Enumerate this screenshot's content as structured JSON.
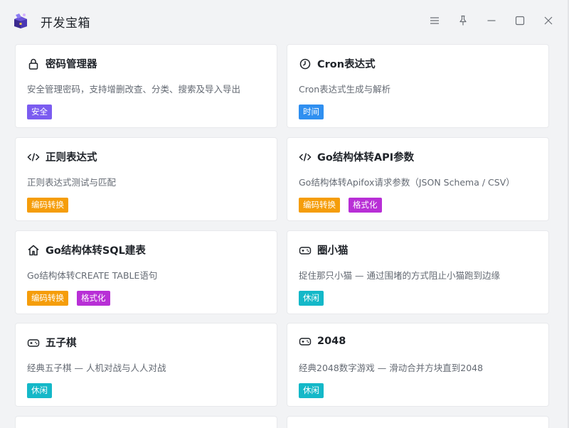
{
  "window": {
    "title": "开发宝箱",
    "controls": [
      "menu-icon",
      "pin-icon",
      "minimize-icon",
      "maximize-icon",
      "close-icon"
    ]
  },
  "colors": {
    "安全": "#7b5cf0",
    "时间": "#2f8ff0",
    "编码转换": "#f59d0a",
    "格式化": "#b82fd6",
    "休闲": "#14b8c8"
  },
  "cards": [
    {
      "title": "密码管理器",
      "icon": "lock-icon",
      "desc": "安全管理密码，支持增删改查、分类、搜索及导入导出",
      "tags": [
        "安全"
      ]
    },
    {
      "title": "Cron表达式",
      "icon": "clock-icon",
      "desc": "Cron表达式生成与解析",
      "tags": [
        "时间"
      ]
    },
    {
      "title": "正则表达式",
      "icon": "code-icon",
      "desc": "正则表达式测试与匹配",
      "tags": [
        "编码转换"
      ]
    },
    {
      "title": "Go结构体转API参数",
      "icon": "code-icon",
      "desc": "Go结构体转Apifox请求参数（JSON Schema / CSV）",
      "tags": [
        "编码转换",
        "格式化"
      ]
    },
    {
      "title": "Go结构体转SQL建表",
      "icon": "home-icon",
      "desc": "Go结构体转CREATE TABLE语句",
      "tags": [
        "编码转换",
        "格式化"
      ]
    },
    {
      "title": "圈小猫",
      "icon": "gamepad-icon",
      "desc": "捉住那只小猫 — 通过围堵的方式阻止小猫跑到边缘",
      "tags": [
        "休闲"
      ]
    },
    {
      "title": "五子棋",
      "icon": "gamepad-icon",
      "desc": "经典五子棋 — 人机对战与人人对战",
      "tags": [
        "休闲"
      ]
    },
    {
      "title": "2048",
      "icon": "gamepad-icon",
      "desc": "经典2048数字游戏 — 滑动合并方块直到2048",
      "tags": [
        "休闲"
      ]
    }
  ]
}
